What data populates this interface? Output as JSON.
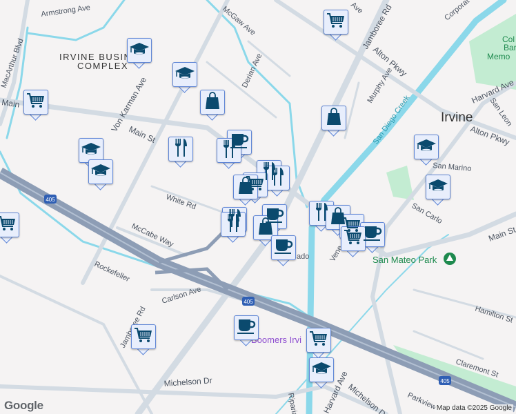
{
  "map": {
    "colors": {
      "background": "#f5f3f3",
      "road": "#d3dbe3",
      "freeway": "#8d9db5",
      "water": "#8bd8ea",
      "park": "#c3ecd2",
      "marker_icon": "#0b4a6e",
      "marker_bg": "#e8eefc"
    },
    "labels": {
      "armstrong": "Armstrong Ave",
      "macarthur": "MacArthur Blvd",
      "irvine_business_1": "IRVINE BUSIN",
      "irvine_business_2": "COMPLEX",
      "main_w": "Main",
      "von_karman": "Von Karman Ave",
      "main_st": "Main St",
      "mcgaw": "McGaw Ave",
      "derian": "Derian Ave",
      "jamboree": "Jamboree Rd",
      "alton": "Alton Pkwy",
      "alton2": "Alton Pkwy",
      "murphy": "Murphy Ave",
      "corporate": "Corporat",
      "san_diego_creek": "San Diego Creek",
      "irvine": "Irvine",
      "harvard": "Harvard Ave",
      "san_leon": "San Leon",
      "san_marino": "San Marino",
      "san_carlo": "San Carlo",
      "main_e": "Main St",
      "san_mateo_park": "San Mateo Park",
      "white": "White Rd",
      "mccabe": "McCabe Way",
      "rockefeller": "Rockefeller",
      "carlson": "Carlson Ave",
      "jamboree2": "Jamboree Rd",
      "hamilton": "Hamilton St",
      "claremont": "Claremont St",
      "michelson_w": "Michelson Dr",
      "michelson_e": "Michelson Dr",
      "harvard2": "Harvard Ave",
      "parkview": "Parkview",
      "riparia": "Riparia",
      "boomers": "Boomers Irvi",
      "venet": "Vene",
      "dorado": "ado",
      "memorial_1": "Col",
      "memorial_2": "Bar",
      "memorial_3": "Memo",
      "i405_a": "405",
      "i405_b": "405",
      "i405_c": "405",
      "alton_top": "Ave"
    },
    "markers": [
      "cart",
      "graduation-cap",
      "graduation-cap",
      "shopping-bag",
      "cart",
      "shopping-bag",
      "graduation-cap",
      "graduation-cap",
      "graduation-cap",
      "coffee",
      "restaurant",
      "restaurant",
      "restaurant",
      "restaurant",
      "cart",
      "shopping-bag",
      "graduation-cap",
      "cart",
      "restaurant",
      "restaurant",
      "coffee",
      "shopping-bag",
      "restaurant",
      "shopping-bag",
      "cart",
      "coffee",
      "cart",
      "coffee",
      "coffee",
      "cart",
      "cart",
      "graduation-cap"
    ],
    "attribution": "Map data ©2025 Google",
    "logo": "Google"
  }
}
